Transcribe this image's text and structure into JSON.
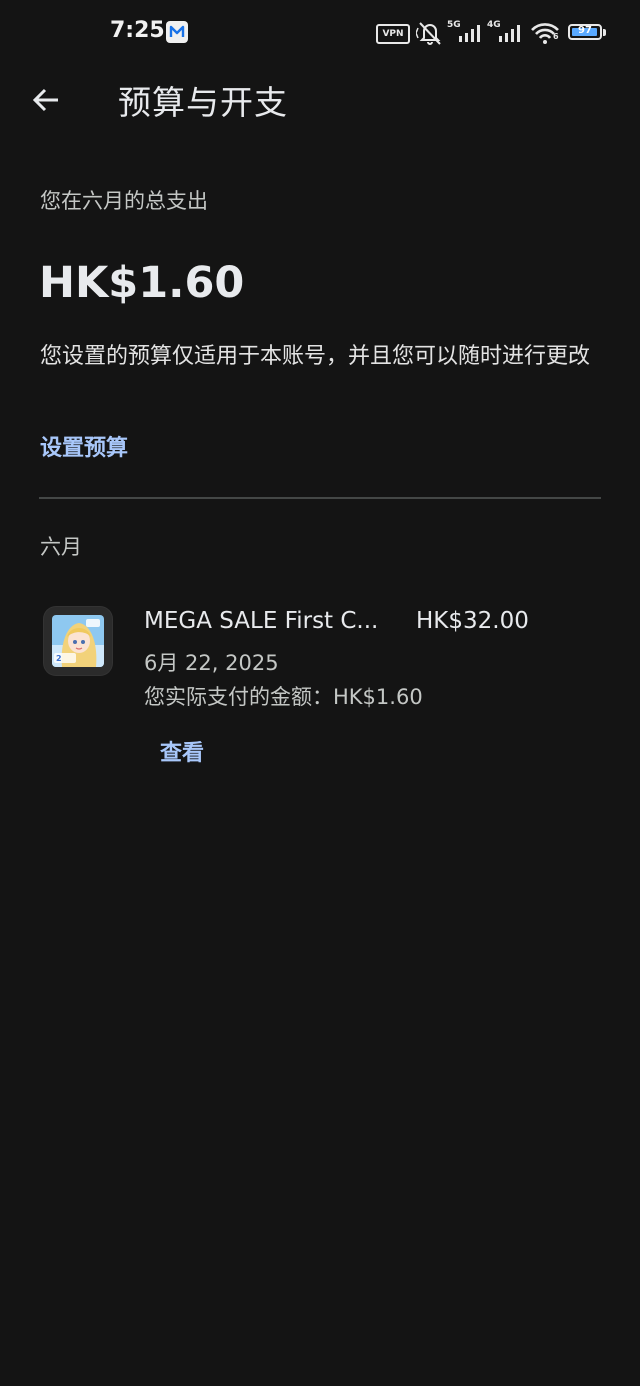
{
  "status_bar": {
    "time": "7:25",
    "vpn": "VPN",
    "net1": "5G",
    "net2": "4G",
    "wifi_sub": "6",
    "battery": 97,
    "battery_text": "97"
  },
  "header": {
    "title": "预算与开支"
  },
  "summary": {
    "label": "您在六月的总支出",
    "total": "HK$1.60",
    "note": "您设置的预算仅适用于本账号，并且您可以随时进行更改",
    "set_budget": "设置预算"
  },
  "month": {
    "label": "六月"
  },
  "transactions": [
    {
      "title": "MEGA SALE First C...",
      "price": "HK$32.00",
      "date": "6月 22, 2025",
      "paid_label": "您实际支付的金额：",
      "paid_amount": "HK$1.60",
      "view": "查看"
    }
  ],
  "colors": {
    "background": "#141414",
    "link": "#a8c7fa",
    "battery_fill": "#59a9ff"
  },
  "icons": [
    "mail-icon",
    "mute-icon",
    "signal-icon",
    "wifi-icon",
    "battery-icon",
    "back-arrow-icon",
    "app-icon"
  ]
}
